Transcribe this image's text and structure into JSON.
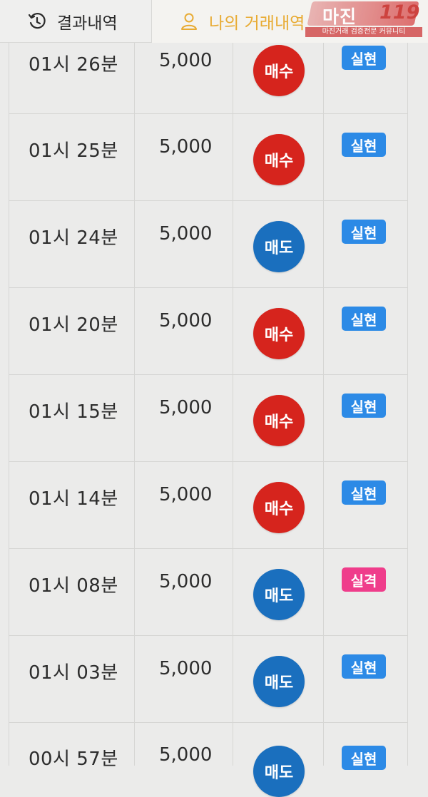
{
  "tabs": {
    "history_label": "결과내역",
    "mytrades_label": "나의 거래내역"
  },
  "watermark": {
    "text": "마진",
    "number": "119",
    "subtitle": "마진거래 검증전문 커뮤니티"
  },
  "colors": {
    "buy": "#d6241d",
    "sell": "#1a6fbe",
    "win_badge": "#2c8ae6",
    "lose_badge": "#ef3d8b",
    "active_tab": "#e8ab33"
  },
  "rows": [
    {
      "time": "01시 26분",
      "amount": "5,000",
      "side": "매수",
      "side_type": "buy",
      "result": "실현",
      "result_type": "win"
    },
    {
      "time": "01시 25분",
      "amount": "5,000",
      "side": "매수",
      "side_type": "buy",
      "result": "실현",
      "result_type": "win"
    },
    {
      "time": "01시 24분",
      "amount": "5,000",
      "side": "매도",
      "side_type": "sell",
      "result": "실현",
      "result_type": "win"
    },
    {
      "time": "01시 20분",
      "amount": "5,000",
      "side": "매수",
      "side_type": "buy",
      "result": "실현",
      "result_type": "win"
    },
    {
      "time": "01시 15분",
      "amount": "5,000",
      "side": "매수",
      "side_type": "buy",
      "result": "실현",
      "result_type": "win"
    },
    {
      "time": "01시 14분",
      "amount": "5,000",
      "side": "매수",
      "side_type": "buy",
      "result": "실현",
      "result_type": "win"
    },
    {
      "time": "01시 08분",
      "amount": "5,000",
      "side": "매도",
      "side_type": "sell",
      "result": "실격",
      "result_type": "lose"
    },
    {
      "time": "01시 03분",
      "amount": "5,000",
      "side": "매도",
      "side_type": "sell",
      "result": "실현",
      "result_type": "win"
    },
    {
      "time": "00시 57분",
      "amount": "5,000",
      "side": "매도",
      "side_type": "sell",
      "result": "실현",
      "result_type": "win"
    }
  ]
}
